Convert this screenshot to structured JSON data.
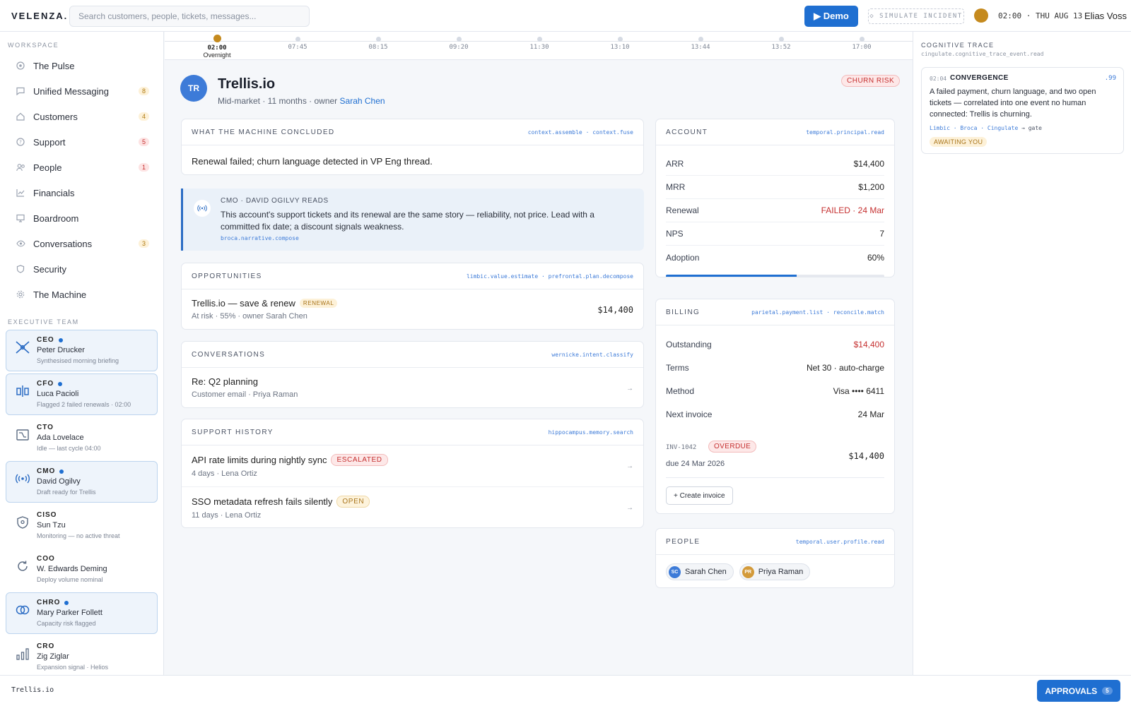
{
  "app": {
    "logo": "VELENZA."
  },
  "header": {
    "search_placeholder": "Search customers, people, tickets, messages...",
    "demo_label": "▶ Demo",
    "simulate_label": "◇ SIMULATE INCIDENT",
    "clock": "02:00 · THU AUG 13",
    "user_name": "Elias Voss"
  },
  "sidebar": {
    "workspace_label": "WORKSPACE",
    "items": [
      {
        "label": "The Pulse",
        "icon": "pulse-icon"
      },
      {
        "label": "Unified Messaging",
        "icon": "chat-icon",
        "badge": "8"
      },
      {
        "label": "Customers",
        "icon": "home-icon",
        "badge": "4"
      },
      {
        "label": "Support",
        "icon": "help-icon",
        "badge": "5"
      },
      {
        "label": "People",
        "icon": "people-icon",
        "badge": "1"
      },
      {
        "label": "Financials",
        "icon": "chart-icon"
      },
      {
        "label": "Boardroom",
        "icon": "monitor-icon"
      },
      {
        "label": "Conversations",
        "icon": "eye-icon",
        "badge": "3"
      },
      {
        "label": "Security",
        "icon": "shield-icon"
      },
      {
        "label": "The Machine",
        "icon": "gear-icon"
      }
    ],
    "exec_label": "EXECUTIVE TEAM",
    "executives": [
      {
        "role": "CEO",
        "name": "Peter Drucker",
        "status": "Synthesised morning briefing",
        "active": true
      },
      {
        "role": "CFO",
        "name": "Luca Pacioli",
        "status": "Flagged 2 failed renewals · 02:00",
        "active": true
      },
      {
        "role": "CTO",
        "name": "Ada Lovelace",
        "status": "Idle — last cycle 04:00",
        "active": false
      },
      {
        "role": "CMO",
        "name": "David Ogilvy",
        "status": "Draft ready for Trellis",
        "active": true
      },
      {
        "role": "CISO",
        "name": "Sun Tzu",
        "status": "Monitoring — no active threat",
        "active": false
      },
      {
        "role": "COO",
        "name": "W. Edwards Deming",
        "status": "Deploy volume nominal",
        "active": false
      },
      {
        "role": "CHRO",
        "name": "Mary Parker Follett",
        "status": "Capacity risk flagged",
        "active": true
      },
      {
        "role": "CRO",
        "name": "Zig Ziglar",
        "status": "Expansion signal · Helios",
        "active": false
      }
    ]
  },
  "timeline": {
    "ticks": [
      "02:00",
      "07:45",
      "08:15",
      "09:20",
      "11:30",
      "13:10",
      "13:44",
      "13:52",
      "17:00"
    ],
    "current_sub": "Overnight"
  },
  "account": {
    "initials": "TR",
    "name": "Trellis.io",
    "meta_prefix": "Mid-market · 11 months · owner",
    "owner": "Sarah Chen",
    "risk_badge": "CHURN RISK"
  },
  "concluded": {
    "title": "WHAT THE MACHINE CONCLUDED",
    "tag": "context.assemble · context.fuse",
    "text": "Renewal failed; churn language detected in VP Eng thread."
  },
  "cmo_read": {
    "heading": "CMO · DAVID OGILVY READS",
    "body": "This account's support tickets and its renewal are the same story — reliability, not price. Lead with a committed fix date; a discount signals weakness.",
    "tag": "broca.narrative.compose"
  },
  "opportunities": {
    "title": "OPPORTUNITIES",
    "tag": "limbic.value.estimate · prefrontal.plan.decompose",
    "items": [
      {
        "title": "Trellis.io — save & renew",
        "pill": "RENEWAL",
        "sub": "At risk · 55% · owner Sarah Chen",
        "amount": "$14,400"
      }
    ]
  },
  "conversations": {
    "title": "CONVERSATIONS",
    "tag": "wernicke.intent.classify",
    "items": [
      {
        "title": "Re: Q2 planning",
        "sub": "Customer email · Priya Raman"
      }
    ]
  },
  "support_history": {
    "title": "SUPPORT HISTORY",
    "tag": "hippocampus.memory.search",
    "items": [
      {
        "title": "API rate limits during nightly sync",
        "pill": "ESCALATED",
        "sub": "4 days · Lena Ortiz"
      },
      {
        "title": "SSO metadata refresh fails silently",
        "pill": "OPEN",
        "sub": "11 days · Lena Ortiz"
      }
    ]
  },
  "account_card": {
    "title": "ACCOUNT",
    "tag": "temporal.principal.read",
    "rows": [
      {
        "k": "ARR",
        "v": "$14,400"
      },
      {
        "k": "MRR",
        "v": "$1,200"
      },
      {
        "k": "Renewal",
        "v": "FAILED · 24 Mar",
        "red": true
      },
      {
        "k": "NPS",
        "v": "7"
      },
      {
        "k": "Adoption",
        "v": "60%"
      }
    ],
    "adoption_fraction": 0.6
  },
  "billing": {
    "title": "BILLING",
    "tag": "parietal.payment.list · reconcile.match",
    "rows": [
      {
        "k": "Outstanding",
        "v": "$14,400",
        "red": true
      },
      {
        "k": "Terms",
        "v": "Net 30 · auto-charge"
      },
      {
        "k": "Method",
        "v": "Visa •••• 6411"
      },
      {
        "k": "Next invoice",
        "v": "24 Mar"
      }
    ],
    "invoice": {
      "id": "INV-1042",
      "status": "OVERDUE",
      "due": "due 24 Mar 2026",
      "amount": "$14,400"
    },
    "create_label": "+ Create invoice"
  },
  "people": {
    "title": "PEOPLE",
    "tag": "temporal.user.profile.read",
    "items": [
      {
        "initials": "SC",
        "name": "Sarah Chen",
        "color": "#3d7bd8"
      },
      {
        "initials": "PR",
        "name": "Priya Raman",
        "color": "#d39a3a"
      }
    ]
  },
  "trace": {
    "title": "COGNITIVE TRACE",
    "sub": "cingulate.cognitive_trace_event.read",
    "event": {
      "time": "02:04",
      "kind": "CONVERGENCE",
      "score": ".99",
      "body": "A failed payment, churn language, and two open tickets — correlated into one event no human connected: Trellis is churning.",
      "chain": [
        "Limbic",
        "Broca",
        "Cingulate"
      ],
      "chain_end": "→ gate",
      "status": "AWAITING YOU"
    }
  },
  "footer": {
    "label": "Trellis.io",
    "approvals_label": "APPROVALS",
    "approvals_count": "5"
  }
}
